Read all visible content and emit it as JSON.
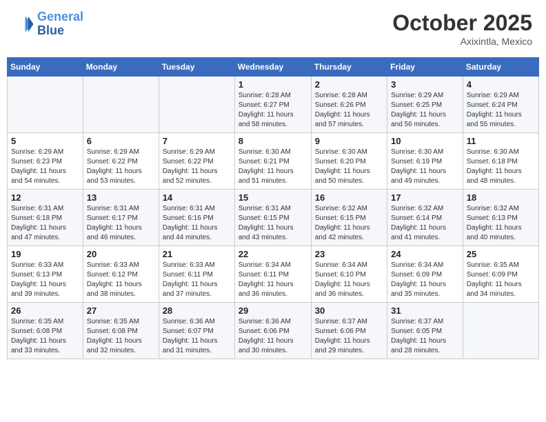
{
  "header": {
    "logo_line1": "General",
    "logo_line2": "Blue",
    "month": "October 2025",
    "location": "Axixintla, Mexico"
  },
  "days_of_week": [
    "Sunday",
    "Monday",
    "Tuesday",
    "Wednesday",
    "Thursday",
    "Friday",
    "Saturday"
  ],
  "weeks": [
    [
      {
        "day": "",
        "info": ""
      },
      {
        "day": "",
        "info": ""
      },
      {
        "day": "",
        "info": ""
      },
      {
        "day": "1",
        "info": "Sunrise: 6:28 AM\nSunset: 6:27 PM\nDaylight: 11 hours\nand 58 minutes."
      },
      {
        "day": "2",
        "info": "Sunrise: 6:28 AM\nSunset: 6:26 PM\nDaylight: 11 hours\nand 57 minutes."
      },
      {
        "day": "3",
        "info": "Sunrise: 6:29 AM\nSunset: 6:25 PM\nDaylight: 11 hours\nand 56 minutes."
      },
      {
        "day": "4",
        "info": "Sunrise: 6:29 AM\nSunset: 6:24 PM\nDaylight: 11 hours\nand 55 minutes."
      }
    ],
    [
      {
        "day": "5",
        "info": "Sunrise: 6:29 AM\nSunset: 6:23 PM\nDaylight: 11 hours\nand 54 minutes."
      },
      {
        "day": "6",
        "info": "Sunrise: 6:29 AM\nSunset: 6:22 PM\nDaylight: 11 hours\nand 53 minutes."
      },
      {
        "day": "7",
        "info": "Sunrise: 6:29 AM\nSunset: 6:22 PM\nDaylight: 11 hours\nand 52 minutes."
      },
      {
        "day": "8",
        "info": "Sunrise: 6:30 AM\nSunset: 6:21 PM\nDaylight: 11 hours\nand 51 minutes."
      },
      {
        "day": "9",
        "info": "Sunrise: 6:30 AM\nSunset: 6:20 PM\nDaylight: 11 hours\nand 50 minutes."
      },
      {
        "day": "10",
        "info": "Sunrise: 6:30 AM\nSunset: 6:19 PM\nDaylight: 11 hours\nand 49 minutes."
      },
      {
        "day": "11",
        "info": "Sunrise: 6:30 AM\nSunset: 6:18 PM\nDaylight: 11 hours\nand 48 minutes."
      }
    ],
    [
      {
        "day": "12",
        "info": "Sunrise: 6:31 AM\nSunset: 6:18 PM\nDaylight: 11 hours\nand 47 minutes."
      },
      {
        "day": "13",
        "info": "Sunrise: 6:31 AM\nSunset: 6:17 PM\nDaylight: 11 hours\nand 46 minutes."
      },
      {
        "day": "14",
        "info": "Sunrise: 6:31 AM\nSunset: 6:16 PM\nDaylight: 11 hours\nand 44 minutes."
      },
      {
        "day": "15",
        "info": "Sunrise: 6:31 AM\nSunset: 6:15 PM\nDaylight: 11 hours\nand 43 minutes."
      },
      {
        "day": "16",
        "info": "Sunrise: 6:32 AM\nSunset: 6:15 PM\nDaylight: 11 hours\nand 42 minutes."
      },
      {
        "day": "17",
        "info": "Sunrise: 6:32 AM\nSunset: 6:14 PM\nDaylight: 11 hours\nand 41 minutes."
      },
      {
        "day": "18",
        "info": "Sunrise: 6:32 AM\nSunset: 6:13 PM\nDaylight: 11 hours\nand 40 minutes."
      }
    ],
    [
      {
        "day": "19",
        "info": "Sunrise: 6:33 AM\nSunset: 6:13 PM\nDaylight: 11 hours\nand 39 minutes."
      },
      {
        "day": "20",
        "info": "Sunrise: 6:33 AM\nSunset: 6:12 PM\nDaylight: 11 hours\nand 38 minutes."
      },
      {
        "day": "21",
        "info": "Sunrise: 6:33 AM\nSunset: 6:11 PM\nDaylight: 11 hours\nand 37 minutes."
      },
      {
        "day": "22",
        "info": "Sunrise: 6:34 AM\nSunset: 6:11 PM\nDaylight: 11 hours\nand 36 minutes."
      },
      {
        "day": "23",
        "info": "Sunrise: 6:34 AM\nSunset: 6:10 PM\nDaylight: 11 hours\nand 36 minutes."
      },
      {
        "day": "24",
        "info": "Sunrise: 6:34 AM\nSunset: 6:09 PM\nDaylight: 11 hours\nand 35 minutes."
      },
      {
        "day": "25",
        "info": "Sunrise: 6:35 AM\nSunset: 6:09 PM\nDaylight: 11 hours\nand 34 minutes."
      }
    ],
    [
      {
        "day": "26",
        "info": "Sunrise: 6:35 AM\nSunset: 6:08 PM\nDaylight: 11 hours\nand 33 minutes."
      },
      {
        "day": "27",
        "info": "Sunrise: 6:35 AM\nSunset: 6:08 PM\nDaylight: 11 hours\nand 32 minutes."
      },
      {
        "day": "28",
        "info": "Sunrise: 6:36 AM\nSunset: 6:07 PM\nDaylight: 11 hours\nand 31 minutes."
      },
      {
        "day": "29",
        "info": "Sunrise: 6:36 AM\nSunset: 6:06 PM\nDaylight: 11 hours\nand 30 minutes."
      },
      {
        "day": "30",
        "info": "Sunrise: 6:37 AM\nSunset: 6:06 PM\nDaylight: 11 hours\nand 29 minutes."
      },
      {
        "day": "31",
        "info": "Sunrise: 6:37 AM\nSunset: 6:05 PM\nDaylight: 11 hours\nand 28 minutes."
      },
      {
        "day": "",
        "info": ""
      }
    ]
  ]
}
